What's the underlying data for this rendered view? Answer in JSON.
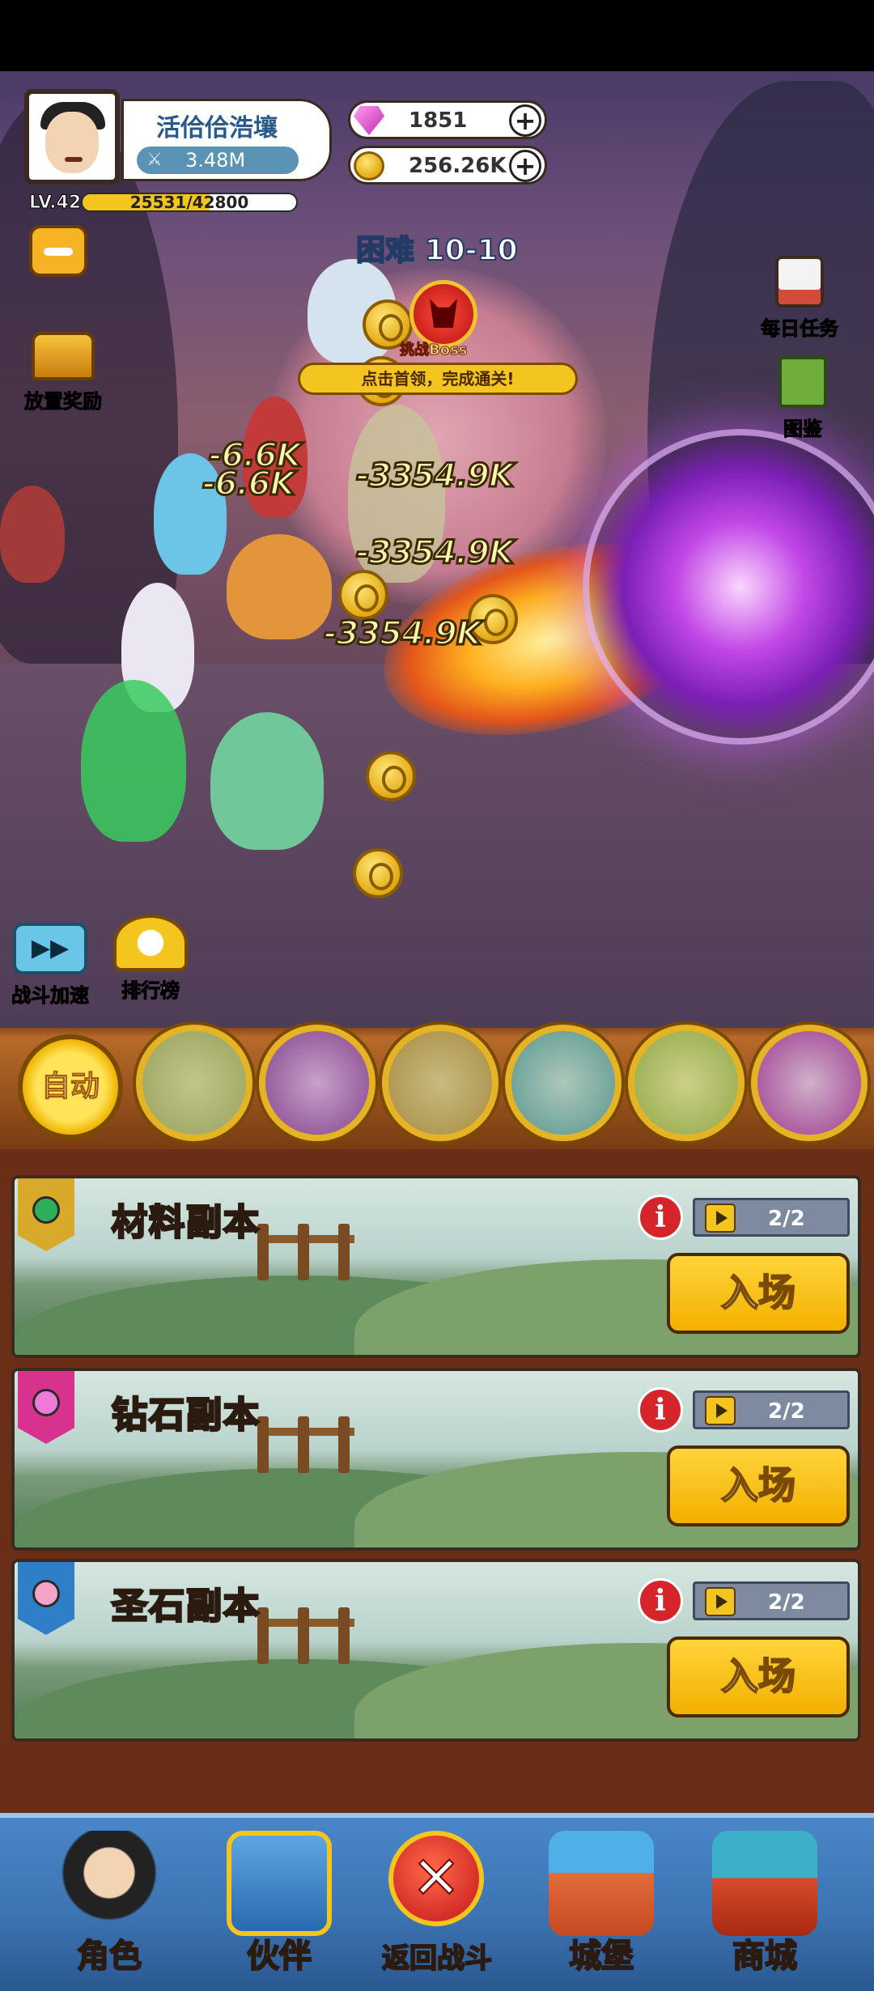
{
  "player": {
    "name": "活佮佮浩壤",
    "power": "3.48M",
    "level": "LV.42",
    "xp_text": "25531/42800",
    "xp_progress": 0.5965
  },
  "resources": {
    "gems": "1851",
    "gold": "256.26K"
  },
  "stage": {
    "difficulty": "困难",
    "level": "10-10",
    "boss_label": "挑战Boss",
    "tip": "点击首领，完成通关!"
  },
  "left_buttons": {
    "idle_reward": "放置奖励",
    "battle_speed": "战斗加速",
    "leaderboard": "排行榜"
  },
  "right_buttons": {
    "daily_tasks": "每日任务",
    "codex": "图鉴"
  },
  "damage_numbers": [
    "-6.6K",
    "-6.6K",
    "-3354.9K",
    "-3354.9K",
    "-3354.9K",
    "-3354.9K"
  ],
  "skills": {
    "auto_label": "自动",
    "icons": [
      "rune-skill-icon",
      "purple-orb-skill-icon",
      "beast-skill-icon",
      "water-spirit-skill-icon",
      "fireball-skill-icon",
      "vortex-skill-icon"
    ]
  },
  "dungeons": [
    {
      "name": "材料副本",
      "flag_color": "#d8a92a",
      "gem_color": "#2fae5a",
      "tickets": "2/2",
      "enter_label": "入场"
    },
    {
      "name": "钻石副本",
      "flag_color": "#d8328f",
      "gem_color": "#f07ad8",
      "tickets": "2/2",
      "enter_label": "入场"
    },
    {
      "name": "圣石副本",
      "flag_color": "#2f7fc8",
      "gem_color": "#f5a3c8",
      "tickets": "2/2",
      "enter_label": "入场"
    }
  ],
  "bottom_nav": {
    "role": "角色",
    "partner": "伙伴",
    "return_battle": "返回战斗",
    "castle": "城堡",
    "shop": "商城"
  }
}
